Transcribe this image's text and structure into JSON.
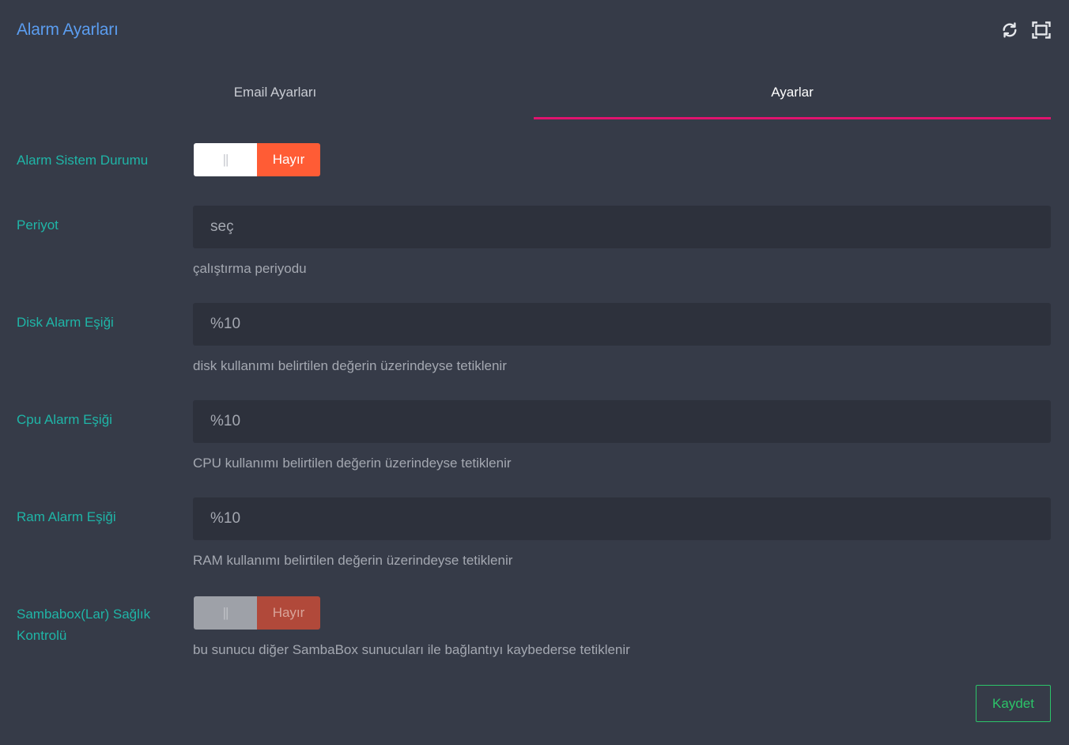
{
  "panel": {
    "title": "Alarm Ayarları",
    "tools": [
      {
        "name": "refresh-icon"
      },
      {
        "name": "fullscreen-icon"
      }
    ]
  },
  "tabs": [
    {
      "label": "Email Ayarları",
      "active": false
    },
    {
      "label": "Ayarlar",
      "active": true
    }
  ],
  "form": {
    "alarm_system_status": {
      "label": "Alarm Sistem Durumu",
      "handle": "||",
      "value": "Hayır"
    },
    "period": {
      "label": "Periyot",
      "value": "seç",
      "help": "çalıştırma periyodu"
    },
    "disk_threshold": {
      "label": "Disk Alarm Eşiği",
      "value": "%10",
      "help": "disk kullanımı belirtilen değerin üzerindeyse tetiklenir"
    },
    "cpu_threshold": {
      "label": "Cpu Alarm Eşiği",
      "value": "%10",
      "help": "CPU kullanımı belirtilen değerin üzerindeyse tetiklenir"
    },
    "ram_threshold": {
      "label": "Ram Alarm Eşiği",
      "value": "%10",
      "help": "RAM kullanımı belirtilen değerin üzerindeyse tetiklenir"
    },
    "sambabox_health": {
      "label": "Sambabox(Lar) Sağlık Kontrolü",
      "handle": "||",
      "value": "Hayır",
      "help": "bu sunucu diğer SambaBox sunucuları ile bağlantıyı kaybederse tetiklenir"
    }
  },
  "actions": {
    "save_label": "Kaydet"
  },
  "colors": {
    "background": "#363b48",
    "title": "#5b9df0",
    "label": "#1fb5a7",
    "tab_underline": "#e0146e",
    "toggle_off": "#ff5c35",
    "save": "#2cc469"
  }
}
